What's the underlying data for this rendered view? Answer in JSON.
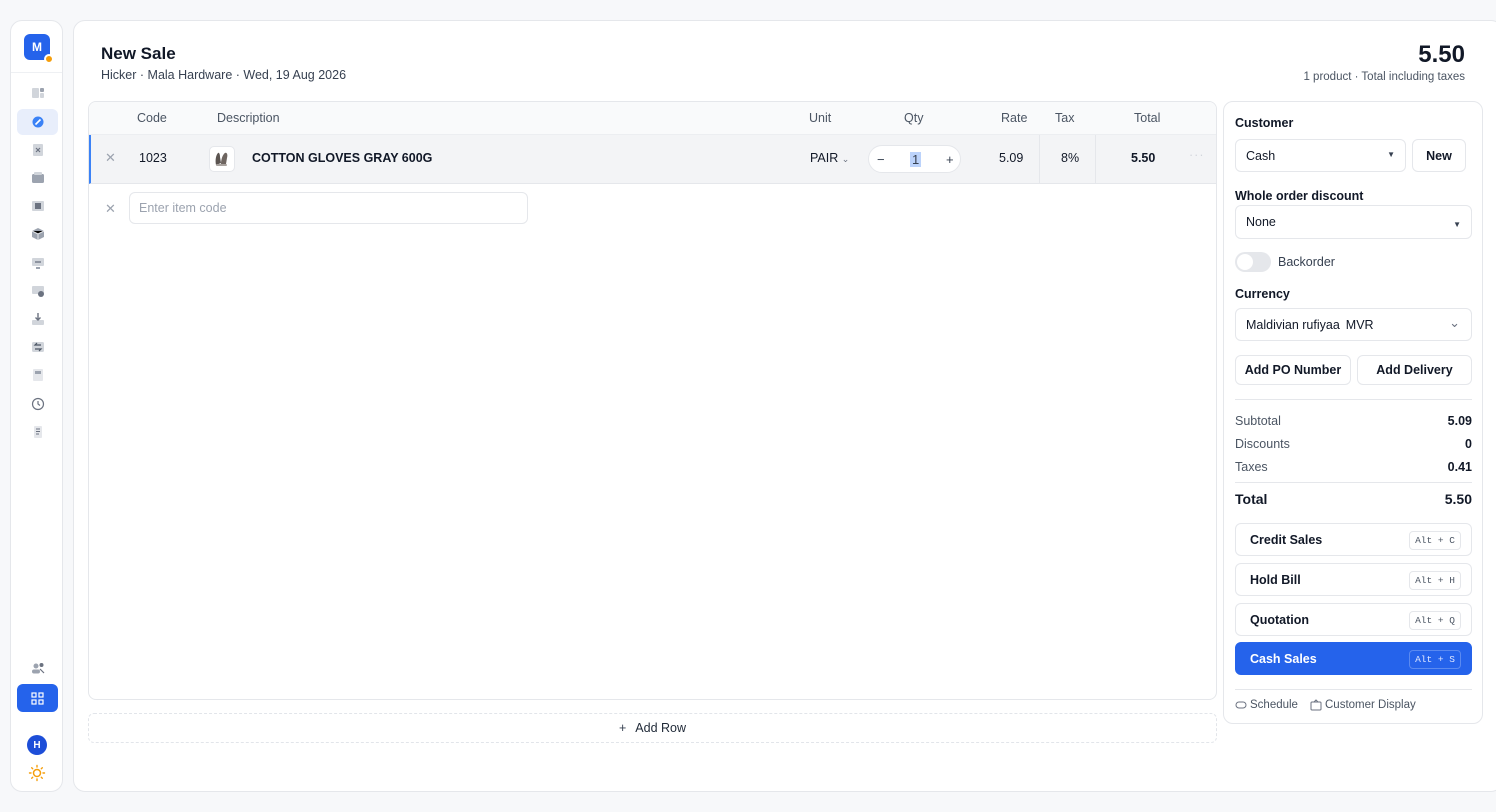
{
  "sidebar": {
    "logo_letter": "M",
    "user_initial": "H",
    "items": [
      "dashboard-icon",
      "sales-icon",
      "invoice-icon",
      "inventory-icon",
      "purchases-icon",
      "products-icon",
      "reports-icon",
      "payments-icon",
      "downloads-icon",
      "returns-icon",
      "documents-icon",
      "history-icon",
      "notes-icon"
    ]
  },
  "header": {
    "title": "New Sale",
    "subtitle": "Hicker · Mala Hardware · Wed, 19 Aug 2026",
    "grand_total": "5.50",
    "grand_total_sub": "1 product · Total including taxes"
  },
  "table": {
    "headers": {
      "code": "Code",
      "description": "Description",
      "unit": "Unit",
      "qty": "Qty",
      "rate": "Rate",
      "tax": "Tax",
      "total": "Total"
    },
    "rows": [
      {
        "code": "1023",
        "description": "COTTON GLOVES GRAY 600G",
        "unit": "PAIR",
        "qty": "1",
        "rate": "5.09",
        "tax": "8%",
        "total": "5.50"
      }
    ],
    "new_row_placeholder": "Enter item code",
    "add_row_label": "Add Row"
  },
  "panel": {
    "customer_label": "Customer",
    "customer_value": "Cash",
    "new_button": "New",
    "discount_label": "Whole order discount",
    "discount_value": "None",
    "backorder_label": "Backorder",
    "currency_label": "Currency",
    "currency_name": "Maldivian rufiyaa",
    "currency_code": "MVR",
    "add_po_label": "Add PO Number",
    "add_delivery_label": "Add Delivery",
    "summary": {
      "subtotal_label": "Subtotal",
      "subtotal": "5.09",
      "discounts_label": "Discounts",
      "discounts": "0",
      "taxes_label": "Taxes",
      "taxes": "0.41",
      "total_label": "Total",
      "total": "5.50"
    },
    "actions": [
      {
        "label": "Credit Sales",
        "shortcut": "Alt + C"
      },
      {
        "label": "Hold Bill",
        "shortcut": "Alt + H"
      },
      {
        "label": "Quotation",
        "shortcut": "Alt + Q"
      },
      {
        "label": "Cash Sales",
        "shortcut": "Alt + S"
      }
    ],
    "schedule_label": "Schedule",
    "customer_display_label": "Customer Display"
  },
  "colors": {
    "accent": "#2563eb",
    "badge": "#f59e0b"
  }
}
